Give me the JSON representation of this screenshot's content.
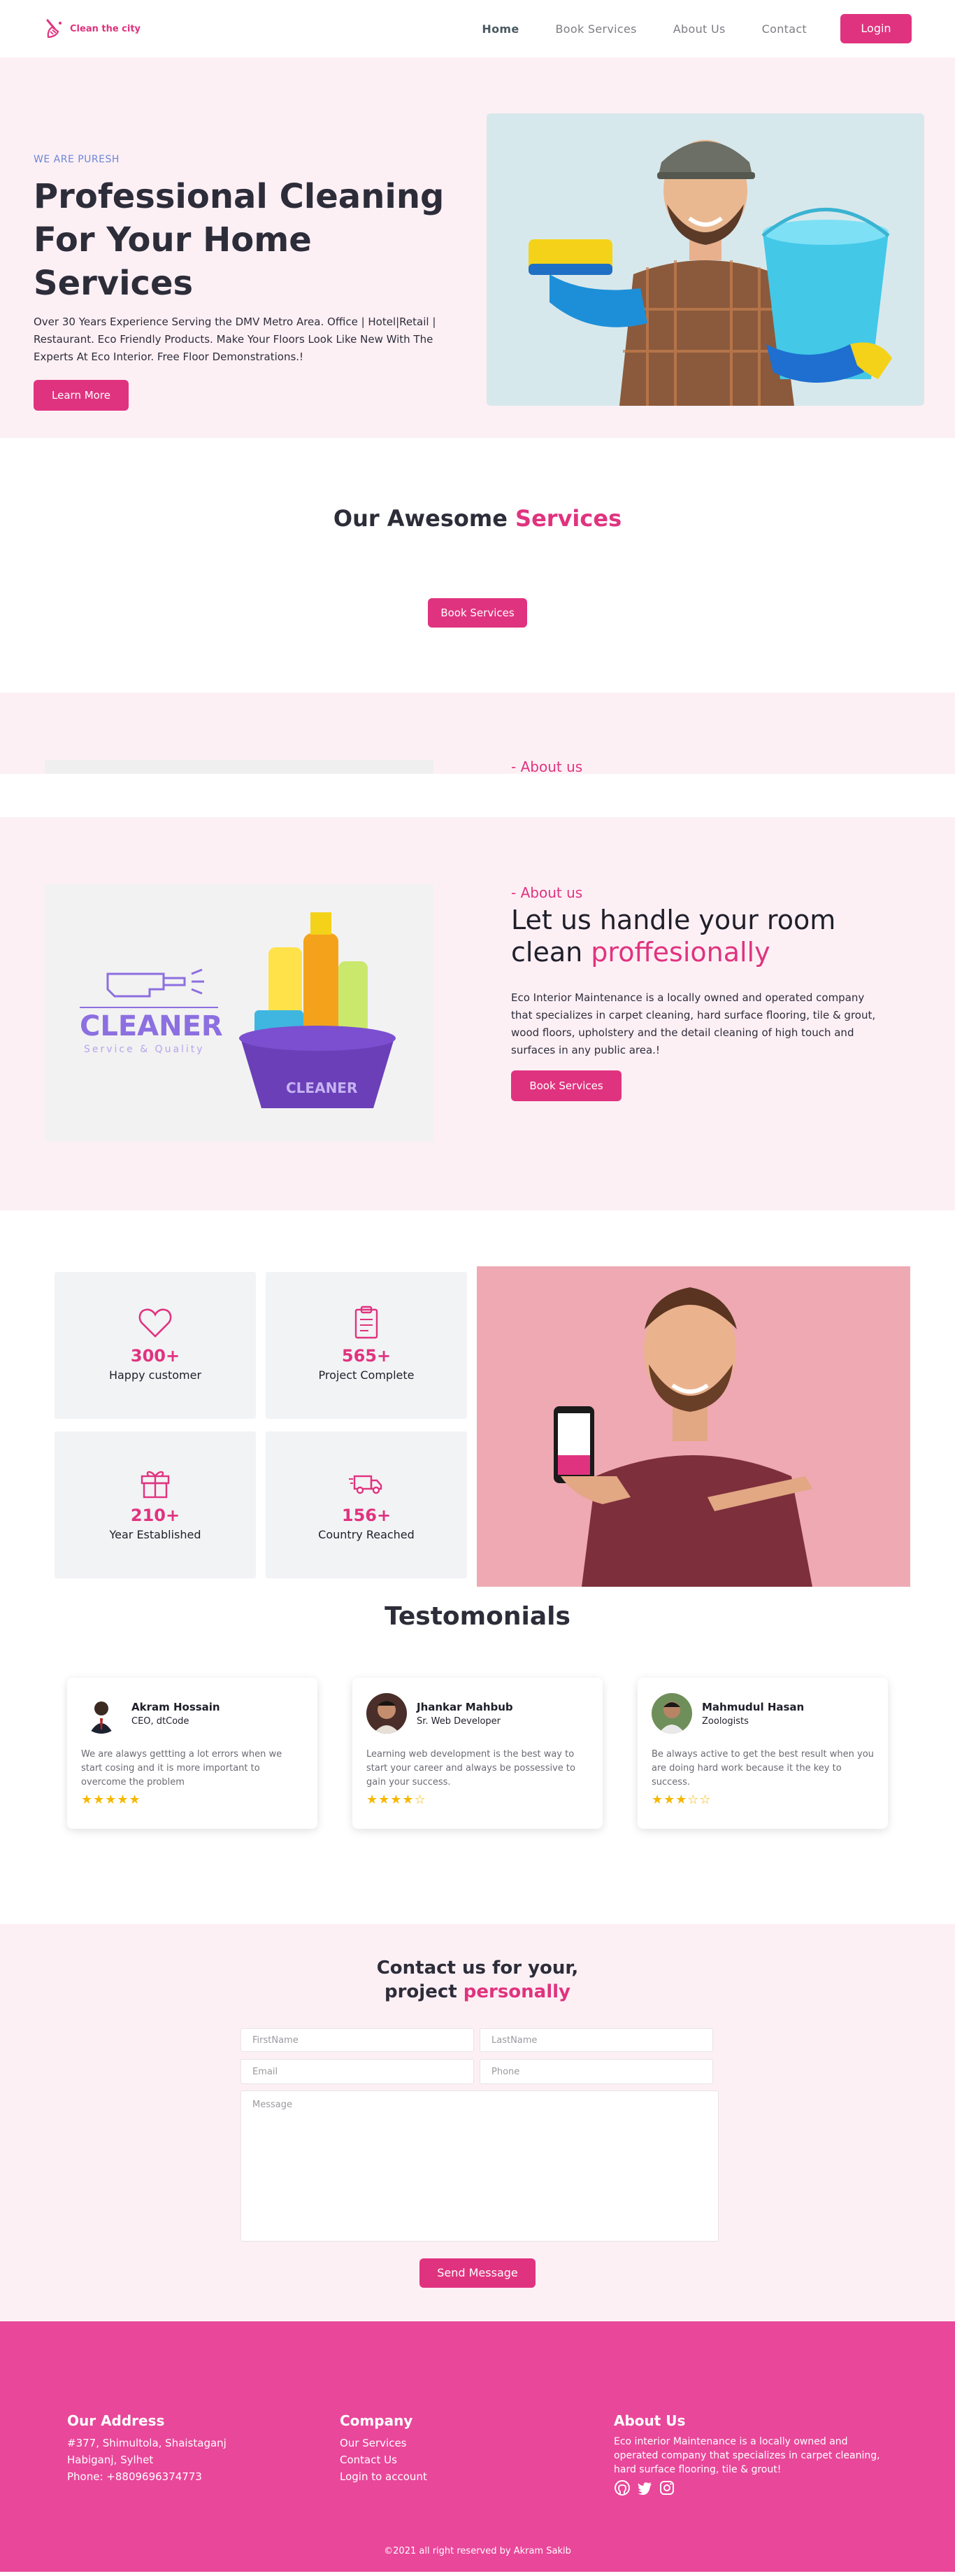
{
  "brand": {
    "name": "Clean the city",
    "color": "#e0337f",
    "logo_icon": "broom-icon"
  },
  "nav": {
    "links": [
      "Home",
      "Book Services",
      "About Us",
      "Contact"
    ],
    "login_label": "Login"
  },
  "hero": {
    "eyebrow": "WE ARE PURESH",
    "title": "Professional Cleaning For Your Home Services",
    "description": "Over 30 Years Experience Serving the DMV Metro Area. Office | Hotel|Retail | Restaurant. Eco Friendly Products. Make Your Floors Look Like New With The Experts At Eco Interior. Free Floor Demonstrations.!",
    "button_label": "Learn More",
    "image_subject": "man-with-cleaning-bucket"
  },
  "services": {
    "title_plain": "Our Awesome",
    "title_accent": "Services",
    "button_label": "Book Services"
  },
  "about_stub": {
    "tag": "- About us"
  },
  "about": {
    "tag": "- About us",
    "title_plain": "Let us handle your room clean",
    "title_accent": "proffesionally",
    "description": "Eco Interior Maintenance is a locally owned and operated company that specializes in carpet cleaning, hard surface flooring, tile & grout, wood floors, upholstery and the detail cleaning of high touch and surfaces in any public area.!",
    "button_label": "Book Services",
    "image_text": {
      "brand": "CLEANER",
      "tagline": "Service & Quality"
    }
  },
  "stats": [
    {
      "icon": "heart-icon",
      "value": "300+",
      "label": "Happy customer"
    },
    {
      "icon": "clipboard-icon",
      "value": "565+",
      "label": "Project Complete"
    },
    {
      "icon": "gift-icon",
      "value": "210+",
      "label": "Year Established"
    },
    {
      "icon": "truck-icon",
      "value": "156+",
      "label": "Country Reached"
    }
  ],
  "testimonials": {
    "title": "Testomonials",
    "items": [
      {
        "name": "Akram Hossain",
        "role": "CEO, dtCode",
        "text": "We are alawys gettting a lot errors when we start cosing and it is more important to overcome the problem",
        "rating": 5,
        "stars": "★★★★★"
      },
      {
        "name": "Jhankar Mahbub",
        "role": "Sr. Web Developer",
        "text": "Learning web development is the best way to start your career and always be possessive to gain your success.",
        "rating": 4,
        "stars": "★★★★☆"
      },
      {
        "name": "Mahmudul Hasan",
        "role": "Zoologists",
        "text": "Be always active to get the best result when you are doing hard work because it the key to success.",
        "rating": 3,
        "stars": "★★★☆☆"
      }
    ]
  },
  "contact": {
    "title_line1": "Contact us for your,",
    "title_line2_plain": "project",
    "title_line2_accent": "personally",
    "placeholders": {
      "first_name": "FirstName",
      "last_name": "LastName",
      "email": "Email",
      "phone": "Phone",
      "message": "Message"
    },
    "button_label": "Send Message"
  },
  "footer": {
    "address": {
      "title": "Our Address",
      "line1": "#377, Shimultola, Shaistaganj",
      "line2": "Habiganj, Sylhet",
      "line3": "Phone: +8809696374773"
    },
    "company": {
      "title": "Company",
      "links": [
        "Our Services",
        "Contact Us",
        "Login to account"
      ]
    },
    "about": {
      "title": "About Us",
      "text": "Eco interior Maintenance is a locally owned and operated company that specializes in carpet cleaning, hard surface flooring, tile & grout!",
      "socials": [
        "github-icon",
        "twitter-icon",
        "instagram-icon"
      ]
    },
    "copyright": "©2021 all right reserved by Akram Sakib",
    "background": "#e9479a"
  }
}
